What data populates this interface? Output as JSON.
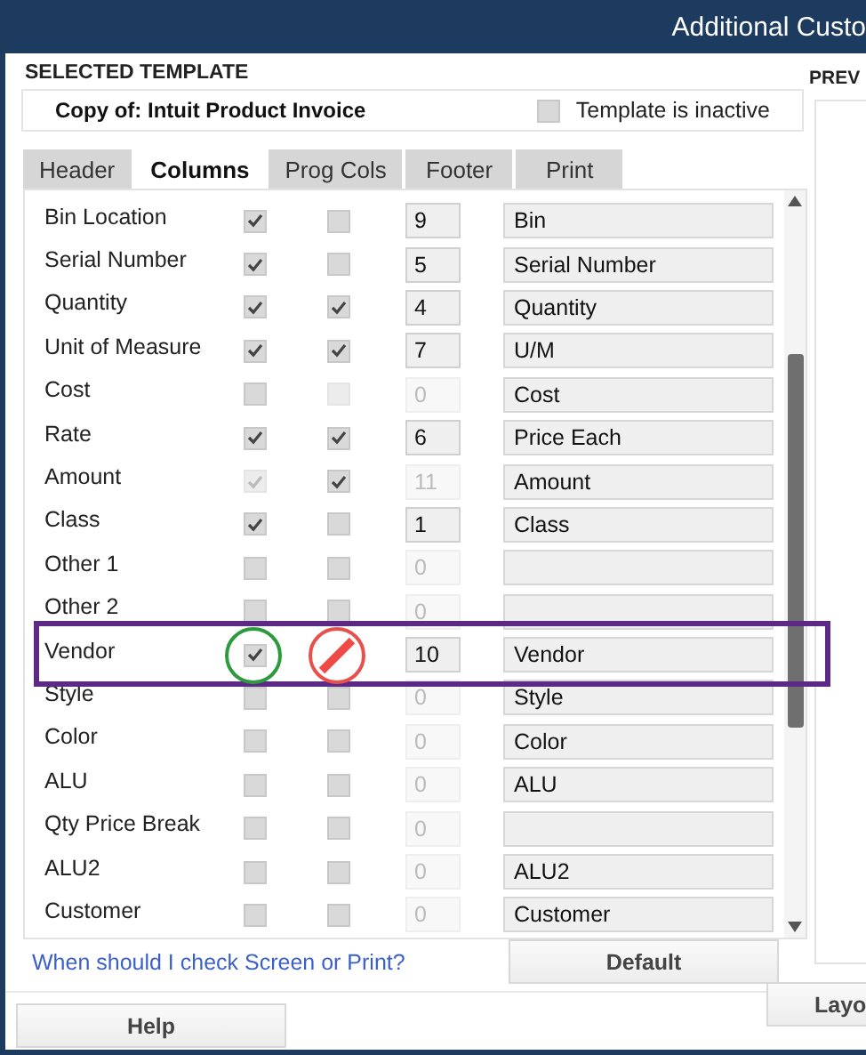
{
  "window": {
    "title": "Additional Custo"
  },
  "template": {
    "section_label": "SELECTED TEMPLATE",
    "name": "Copy of: Intuit Product Invoice",
    "inactive_label": "Template is inactive",
    "inactive": false
  },
  "tabs": [
    {
      "label": "Header",
      "selected": false
    },
    {
      "label": "Columns",
      "selected": true
    },
    {
      "label": "Prog Cols",
      "selected": false
    },
    {
      "label": "Footer",
      "selected": false
    },
    {
      "label": "Print",
      "selected": false
    }
  ],
  "rows": [
    {
      "name": "Bin Location",
      "screen": true,
      "screen_disabled": false,
      "print": false,
      "print_disabled": false,
      "order": "9",
      "order_disabled": false,
      "title": "Bin",
      "highlighted": false
    },
    {
      "name": "Serial Number",
      "screen": true,
      "screen_disabled": false,
      "print": false,
      "print_disabled": false,
      "order": "5",
      "order_disabled": false,
      "title": "Serial Number",
      "highlighted": false
    },
    {
      "name": "Quantity",
      "screen": true,
      "screen_disabled": false,
      "print": true,
      "print_disabled": false,
      "order": "4",
      "order_disabled": false,
      "title": "Quantity",
      "highlighted": false
    },
    {
      "name": "Unit of Measure",
      "screen": true,
      "screen_disabled": false,
      "print": true,
      "print_disabled": false,
      "order": "7",
      "order_disabled": false,
      "title": "U/M",
      "highlighted": false
    },
    {
      "name": "Cost",
      "screen": false,
      "screen_disabled": false,
      "print": false,
      "print_disabled": true,
      "order": "0",
      "order_disabled": true,
      "title": "Cost",
      "highlighted": false
    },
    {
      "name": "Rate",
      "screen": true,
      "screen_disabled": false,
      "print": true,
      "print_disabled": false,
      "order": "6",
      "order_disabled": false,
      "title": "Price Each",
      "highlighted": false
    },
    {
      "name": "Amount",
      "screen": true,
      "screen_disabled": true,
      "print": true,
      "print_disabled": false,
      "order": "11",
      "order_disabled": true,
      "title": "Amount",
      "highlighted": false
    },
    {
      "name": "Class",
      "screen": true,
      "screen_disabled": false,
      "print": false,
      "print_disabled": false,
      "order": "1",
      "order_disabled": false,
      "title": "Class",
      "highlighted": false
    },
    {
      "name": "Other 1",
      "screen": false,
      "screen_disabled": false,
      "print": false,
      "print_disabled": false,
      "order": "0",
      "order_disabled": true,
      "highlighted": false
    },
    {
      "name": "Other 2",
      "screen": false,
      "screen_disabled": false,
      "print": false,
      "print_disabled": false,
      "order": "0",
      "order_disabled": true,
      "highlighted": false
    },
    {
      "name": "Vendor",
      "screen": true,
      "screen_disabled": false,
      "order": "10",
      "order_disabled": false,
      "title": "Vendor",
      "highlighted": true
    },
    {
      "name": "Style",
      "screen": false,
      "screen_disabled": false,
      "print": false,
      "print_disabled": false,
      "order": "0",
      "order_disabled": true,
      "title": "Style",
      "highlighted": false
    },
    {
      "name": "Color",
      "screen": false,
      "screen_disabled": false,
      "print": false,
      "print_disabled": false,
      "order": "0",
      "order_disabled": true,
      "title": "Color",
      "highlighted": false
    },
    {
      "name": "ALU",
      "screen": false,
      "screen_disabled": false,
      "print": false,
      "print_disabled": false,
      "order": "0",
      "order_disabled": true,
      "title": "ALU",
      "highlighted": false
    },
    {
      "name": "Qty Price Break",
      "screen": false,
      "screen_disabled": false,
      "print": false,
      "print_disabled": false,
      "order": "0",
      "order_disabled": true,
      "highlighted": false
    },
    {
      "name": "ALU2",
      "screen": false,
      "screen_disabled": false,
      "print": false,
      "print_disabled": false,
      "order": "0",
      "order_disabled": true,
      "title": "ALU2",
      "highlighted": false
    },
    {
      "name": "Customer",
      "screen": false,
      "screen_disabled": false,
      "print": false,
      "print_disabled": false,
      "order": "0",
      "order_disabled": true,
      "title": "Customer",
      "highlighted": false
    }
  ],
  "help_link": "When should I check Screen or Print?",
  "default_button": "Default",
  "preview_label": "PREV",
  "buttons": [
    "Help",
    "Layo"
  ]
}
